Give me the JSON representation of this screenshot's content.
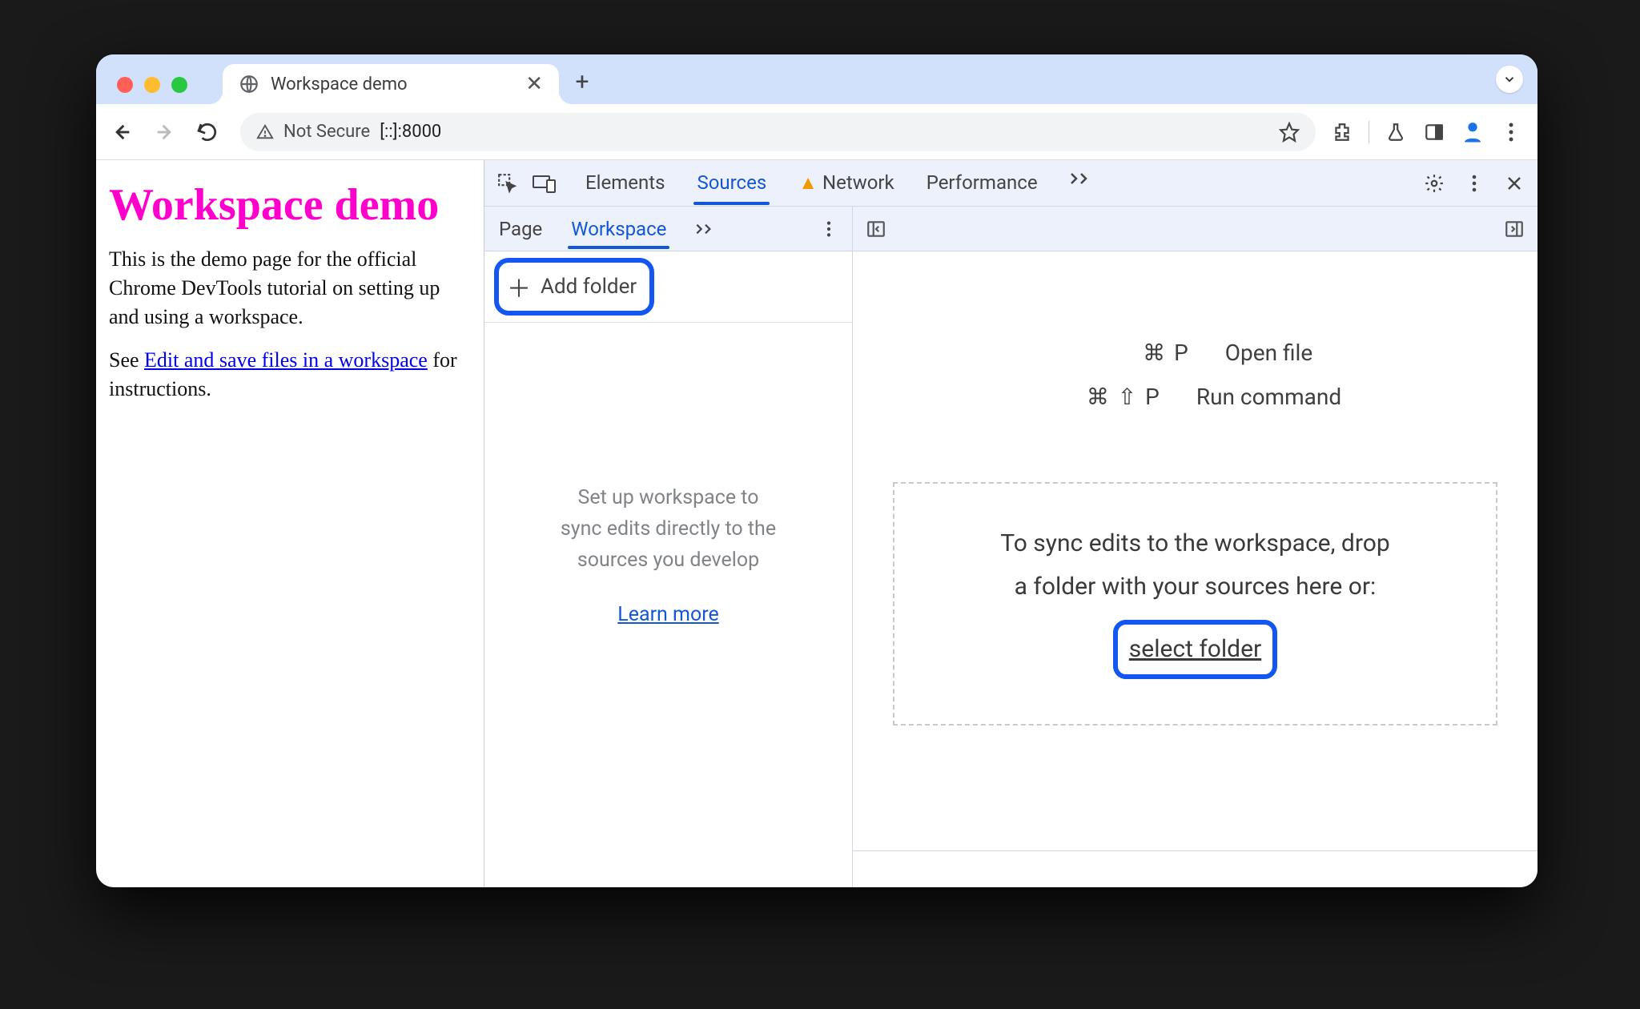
{
  "browser": {
    "tab_title": "Workspace demo",
    "url": "[::]:8000",
    "security_label": "Not Secure"
  },
  "page": {
    "heading": "Workspace demo",
    "para1": "This is the demo page for the official Chrome DevTools tutorial on setting up and using a workspace.",
    "para2_prefix": "See ",
    "para2_link": "Edit and save files in a workspace",
    "para2_suffix": " for instructions."
  },
  "devtools": {
    "tabs": {
      "elements": "Elements",
      "sources": "Sources",
      "network": "Network",
      "performance": "Performance"
    },
    "side": {
      "tabs": {
        "page": "Page",
        "workspace": "Workspace"
      },
      "add_folder": "Add folder",
      "hint_l1": "Set up workspace to",
      "hint_l2": "sync edits directly to the",
      "hint_l3": "sources you develop",
      "learn_more": "Learn more"
    },
    "main": {
      "shortcut1_keys": "⌘ P",
      "shortcut1_label": "Open file",
      "shortcut2_keys": "⌘ ⇧ P",
      "shortcut2_label": "Run command",
      "drop_l1": "To sync edits to the workspace, drop",
      "drop_l2": "a folder with your sources here or:",
      "select_folder": "select folder"
    }
  }
}
